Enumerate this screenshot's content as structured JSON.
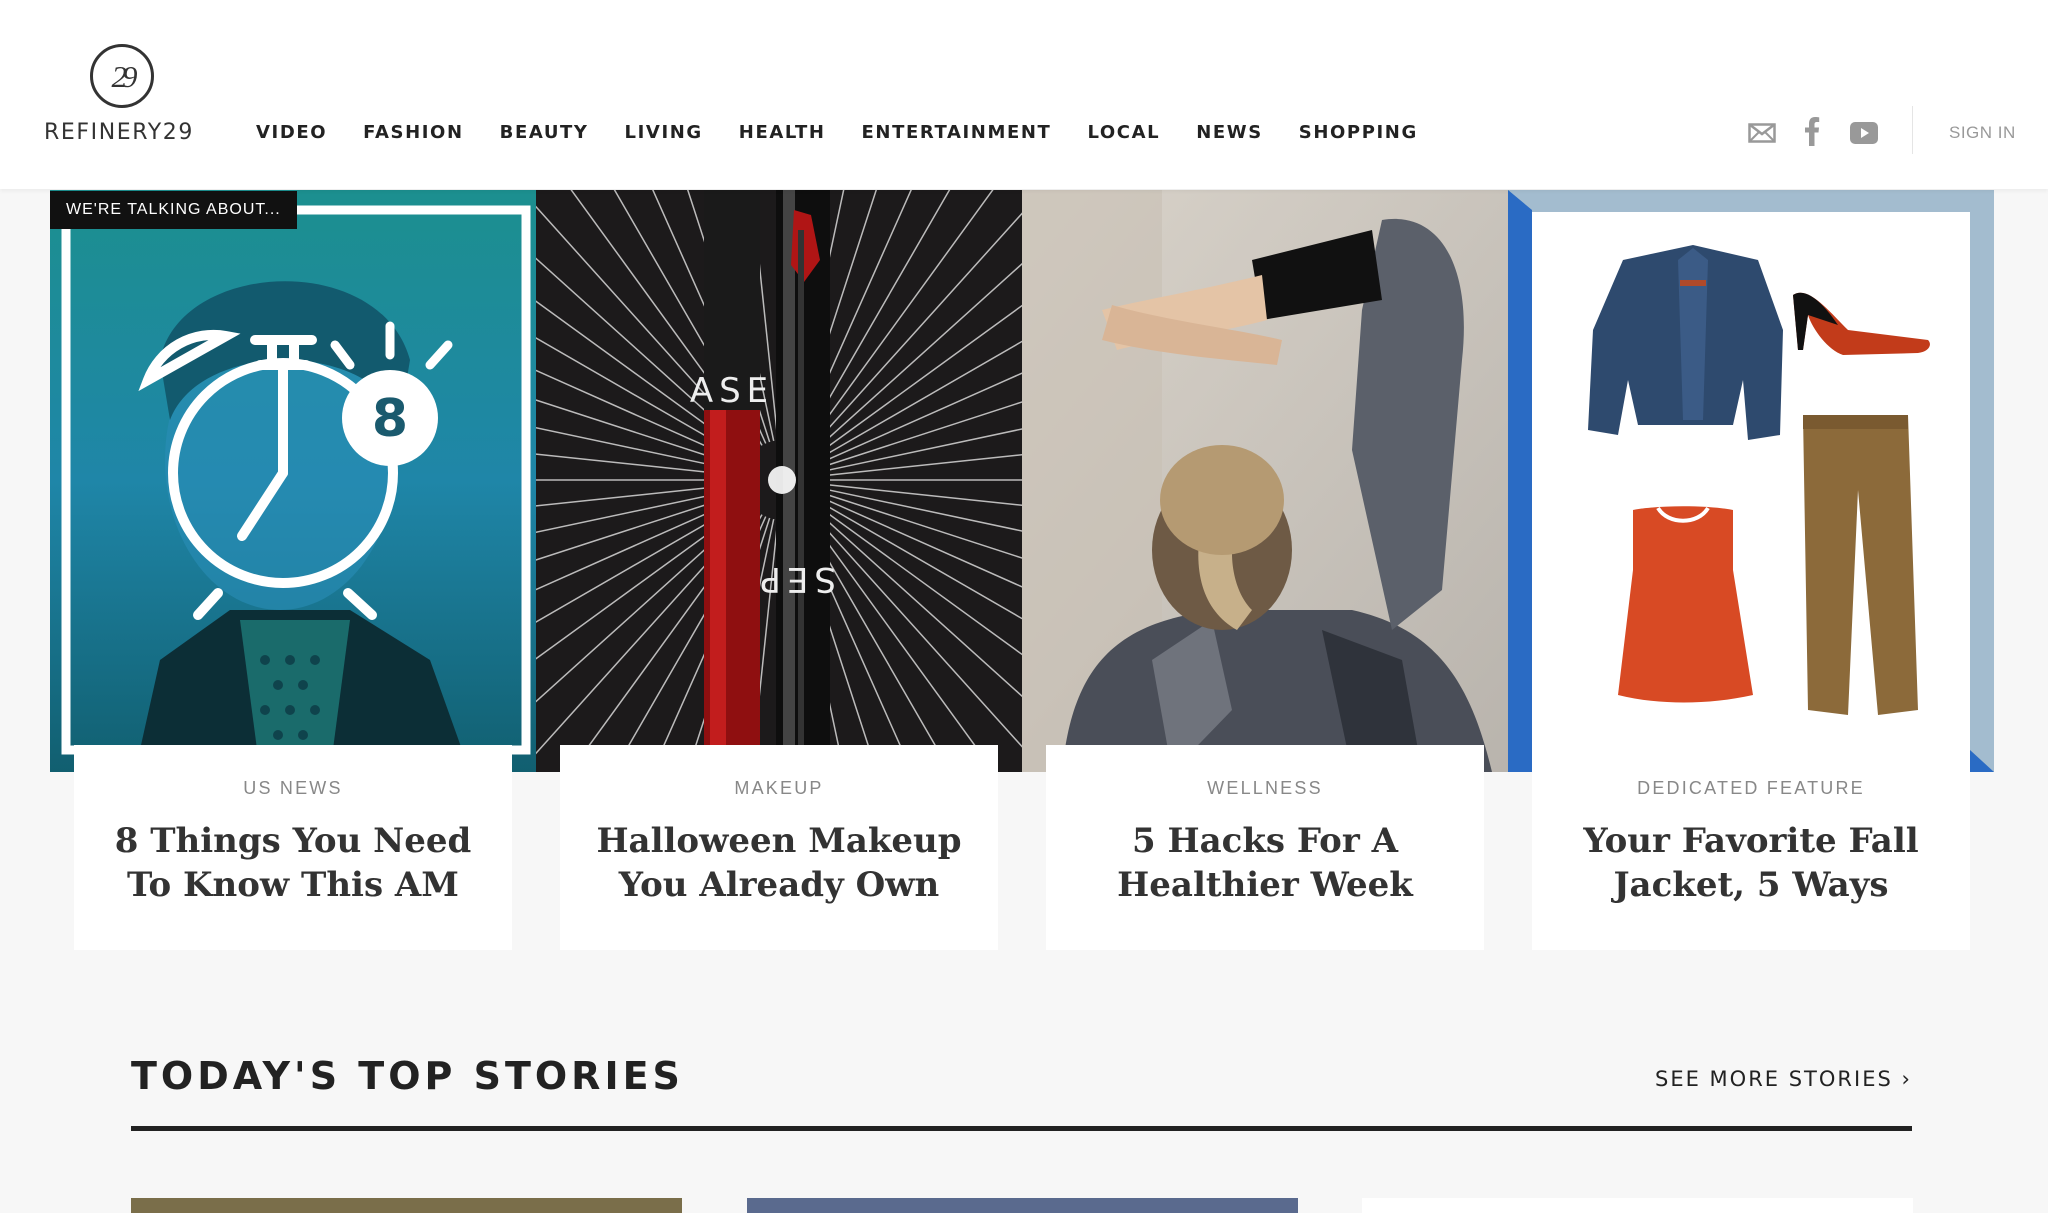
{
  "brand": {
    "logo_mark": "29",
    "wordmark": "REFINERY29"
  },
  "nav": {
    "items": [
      "VIDEO",
      "FASHION",
      "BEAUTY",
      "LIVING",
      "HEALTH",
      "ENTERTAINMENT",
      "LOCAL",
      "NEWS",
      "SHOPPING"
    ]
  },
  "header_right": {
    "icons": [
      "mail-icon",
      "facebook-icon",
      "youtube-icon"
    ],
    "sign_in": "SIGN IN"
  },
  "badge": "WE'RE TALKING ABOUT...",
  "cards": [
    {
      "category": "US NEWS",
      "title": "8 Things You Need To Know This AM",
      "image": "alarm-clock-portrait",
      "overlay_number": "8"
    },
    {
      "category": "MAKEUP",
      "title": "Halloween Makeup You Already Own",
      "image": "red-lipstick",
      "product_text_top": "ASE",
      "product_text_bottom": "SEP"
    },
    {
      "category": "WELLNESS",
      "title": "5 Hacks For A Healthier Week",
      "image": "woman-stretching"
    },
    {
      "category": "DEDICATED FEATURE",
      "title": "Your Favorite Fall Jacket, 5 Ways",
      "image": "outfit-flatlay"
    }
  ],
  "top_stories": {
    "heading": "TODAY'S TOP STORIES",
    "see_more": "SEE MORE STORIES ›"
  },
  "colors": {
    "accent_teal": "#1e8a99",
    "accent_blue": "#2a6bc4",
    "text_dark": "#333333",
    "text_muted": "#888888",
    "background": "#f7f7f7"
  }
}
